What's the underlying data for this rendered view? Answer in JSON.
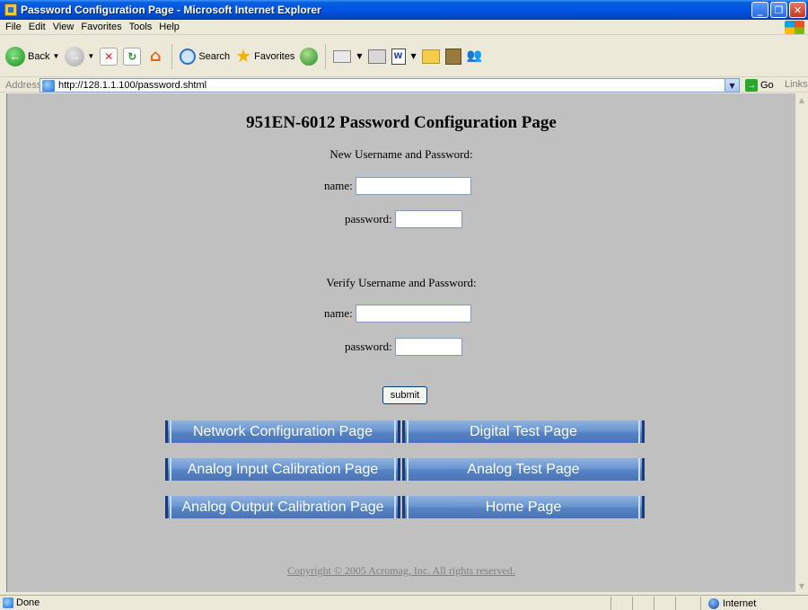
{
  "window": {
    "title": "Password Configuration Page - Microsoft Internet Explorer"
  },
  "menu": [
    "File",
    "Edit",
    "View",
    "Favorites",
    "Tools",
    "Help"
  ],
  "toolbar": {
    "back_label": "Back",
    "search_label": "Search",
    "favorites_label": "Favorites"
  },
  "address": {
    "label": "Address",
    "url": "http://128.1.1.100/password.shtml",
    "go_label": "Go",
    "links_label": "Links"
  },
  "page": {
    "title": "951EN-6012 Password Configuration Page",
    "new_section": "New Username and Password:",
    "verify_section": "Verify Username and Password:",
    "name_label": "name:",
    "password_label": "password:",
    "submit_label": "submit",
    "nav": {
      "network": "Network Configuration Page",
      "digital": "Digital Test Page",
      "analog_input": "Analog Input Calibration Page",
      "analog_test": "Analog Test Page",
      "analog_output": "Analog Output Calibration Page",
      "home": "Home Page"
    },
    "copyright": "Copyright © 2005 Acromag, Inc. All rights reserved."
  },
  "status": {
    "text": "Done",
    "zone": "Internet"
  }
}
